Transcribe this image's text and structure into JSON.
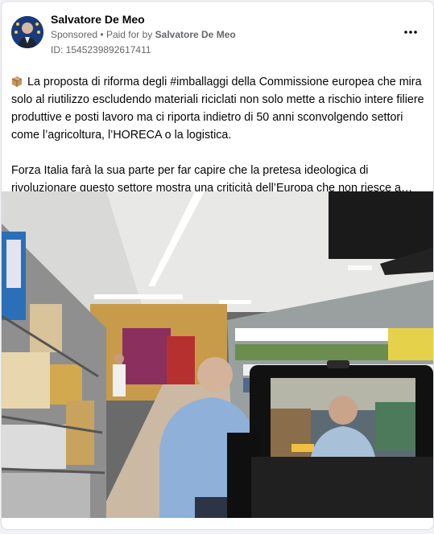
{
  "post": {
    "author": "Salvatore De Meo",
    "sponsored_label": "Sponsored",
    "separator": "•",
    "paid_for_prefix": "Paid for by",
    "paid_for_by": "Salvatore De Meo",
    "ad_id": "ID: 1545239892617411",
    "more_icon": "more-horizontal-icon",
    "paragraph_1": "La proposta di riforma degli #imballaggi della Commissione europea che mira solo al riutilizzo escludendo materiali riciclati non solo mette a rischio intere filiere produttive e posti lavoro ma ci riporta indietro di 50 anni sconvolgendo settori come l’agricoltura, l’HORECA o la logistica.",
    "paragraph_2": "Forza Italia farà la sua parte per far capire che la pretesa ideologica di rivoluzionare questo settore mostra una criticità dell’Europa che non riesce a…",
    "paragraph_icon": "package-emoji-icon"
  },
  "colors": {
    "card_bg": "#ffffff",
    "page_bg": "#f0f2f5",
    "text_primary": "#050505",
    "text_secondary": "#65676b"
  }
}
